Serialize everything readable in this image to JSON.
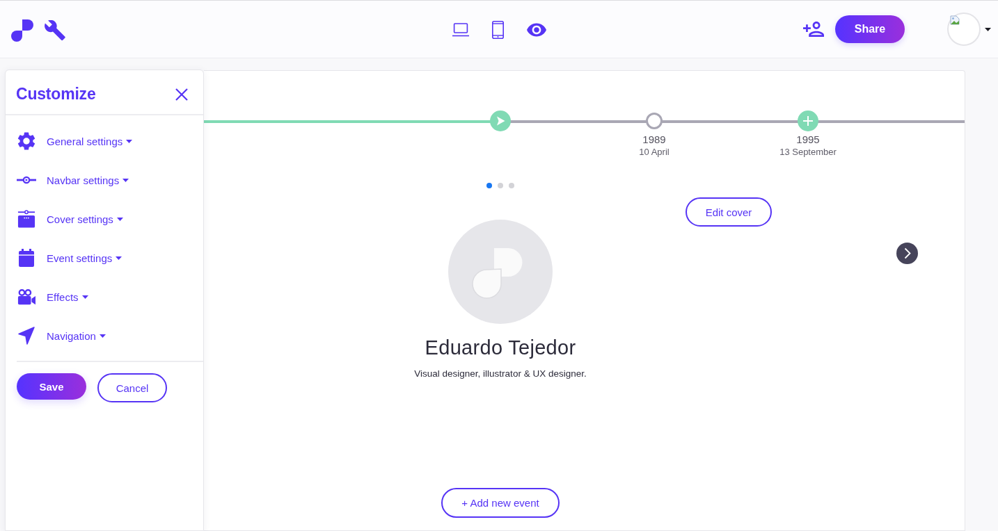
{
  "toolbar": {
    "share_button": "Share"
  },
  "sidebar": {
    "title": "Customize",
    "items": [
      {
        "label": "General settings",
        "expanded": false
      },
      {
        "label": "Navbar settings",
        "expanded": false
      },
      {
        "label": "Cover settings",
        "expanded": false
      },
      {
        "label": "Event settings",
        "expanded": false
      },
      {
        "label": "Effects",
        "expanded": false
      },
      {
        "label": "Navigation",
        "expanded": false
      }
    ],
    "save_button": "Save",
    "cancel_button": "Cancel"
  },
  "timeline": {
    "events": [
      {
        "kind": "current"
      },
      {
        "kind": "event",
        "year": "1989",
        "date": "10 April"
      },
      {
        "kind": "add",
        "year": "1995",
        "date": "13 September"
      }
    ]
  },
  "carousel_dots": [
    {
      "selected": true
    },
    {
      "selected": false
    },
    {
      "selected": false
    }
  ],
  "cover": {
    "edit_button": "Edit cover",
    "name": "Eduardo Tejedor",
    "subtitle": "Visual designer, illustrator & UX designer."
  },
  "add_event_button": "+ Add new event"
}
